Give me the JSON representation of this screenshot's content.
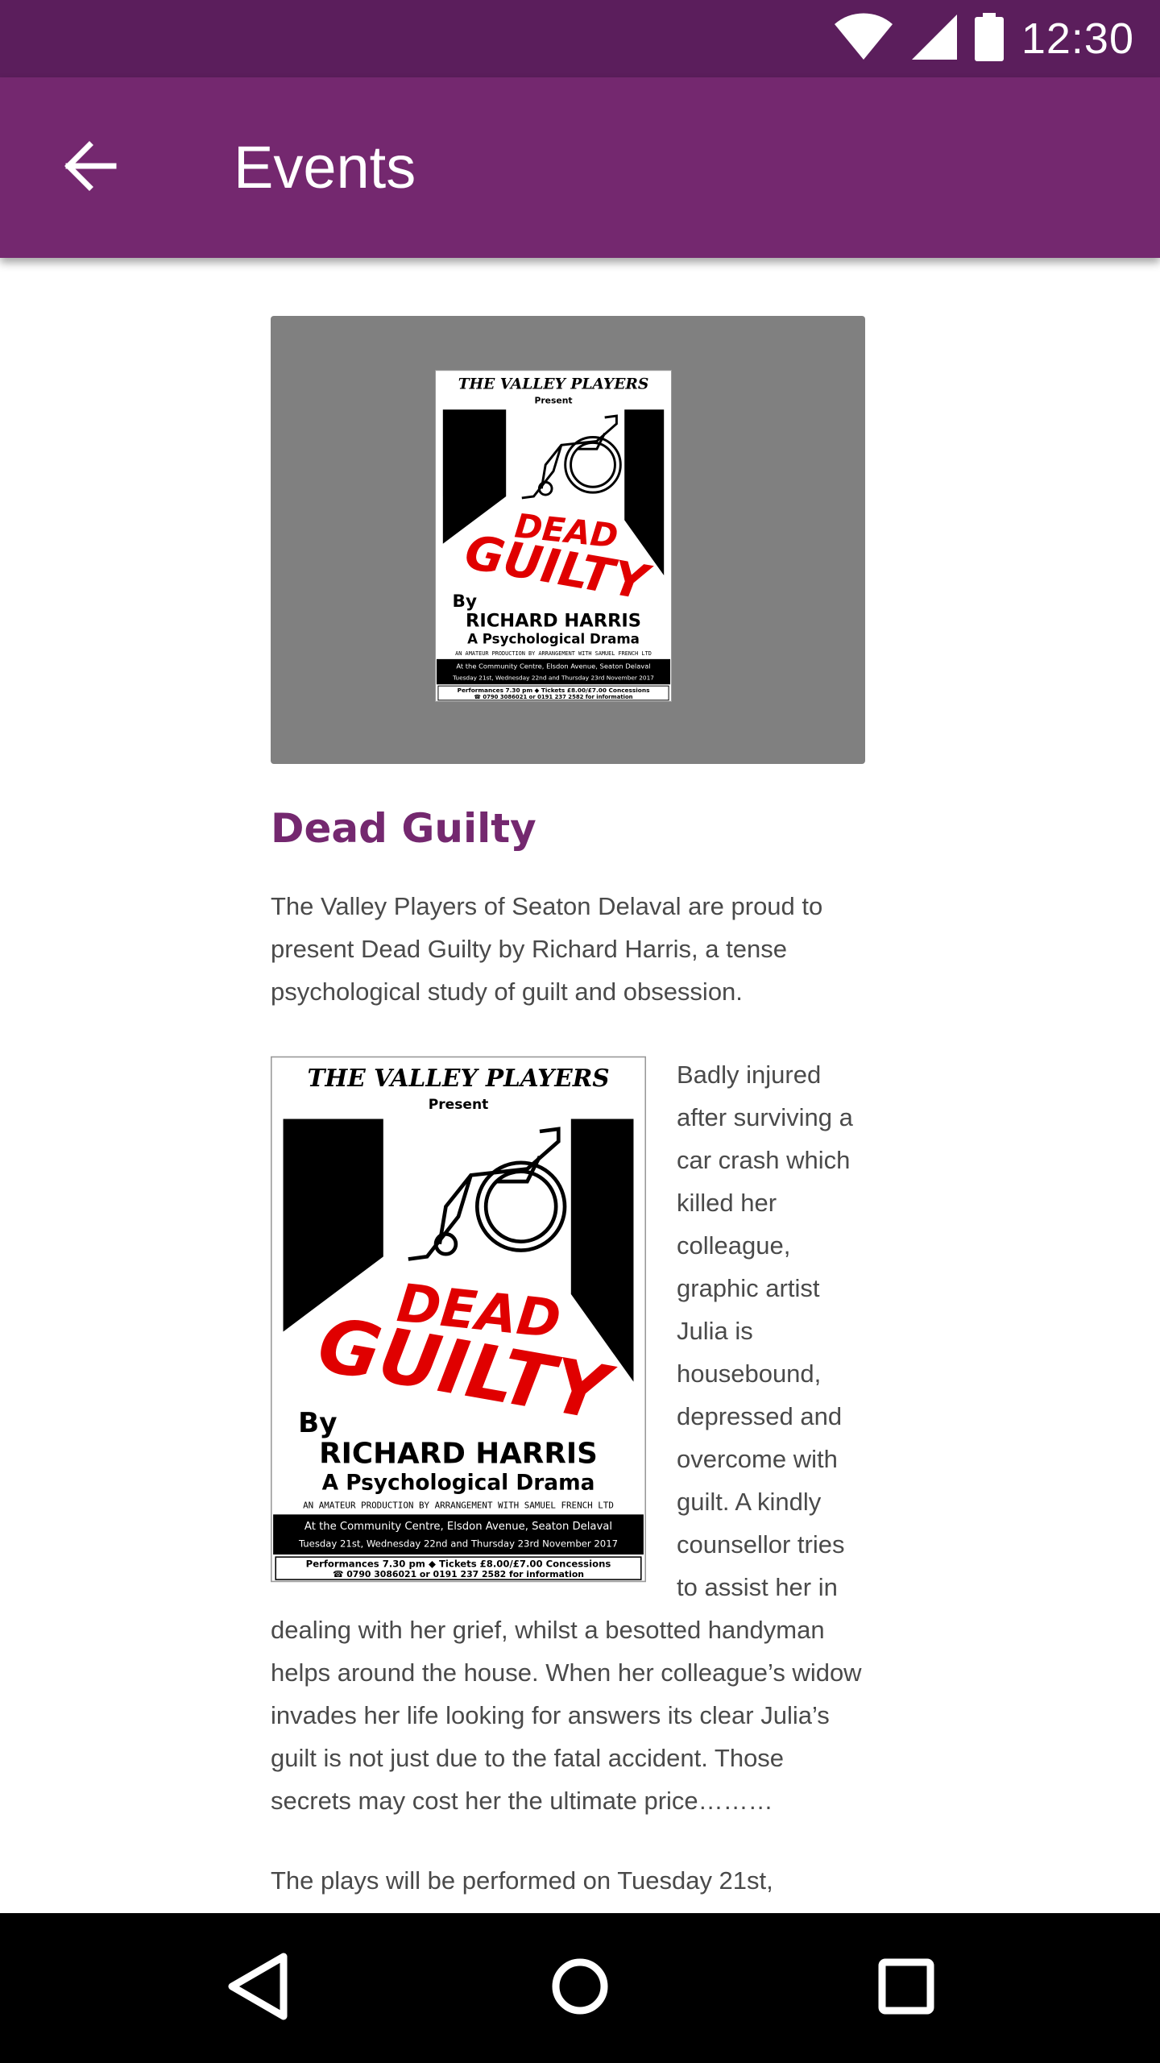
{
  "status_bar": {
    "time": "12:30"
  },
  "app_bar": {
    "title": "Events"
  },
  "event": {
    "title": "Dead Guilty",
    "intro": "The Valley Players of Seaton Delaval are proud to present Dead Guilty by Richard Harris, a tense psychological study of guilt and obsession.",
    "body": "Badly injured after surviving a car crash which killed her colleague, graphic artist Julia is housebound, depressed and overcome with guilt.  A kindly counsellor tries to assist her in dealing with her grief, whilst a besotted handyman helps around the house.  When her colleague’s widow invades her life looking for answers its clear Julia’s guilt is not just due to the fatal accident. Those secrets may cost her the ultimate price………",
    "more": "The plays will be performed on Tuesday 21st,"
  },
  "poster": {
    "header": "THE VALLEY PLAYERS",
    "present": "Present",
    "title_line1": "DEAD",
    "title_line2": "GUILTY",
    "by": "By",
    "author": "RICHARD HARRIS",
    "subtitle": "A Psychological Drama",
    "production": "AN AMATEUR PRODUCTION BY ARRANGEMENT WITH SAMUEL FRENCH LTD",
    "venue": "At the Community Centre, Elsdon Avenue, Seaton Delaval",
    "dates": "Tuesday 21st, Wednesday 22nd and Thursday 23rd November 2017",
    "tickets": "Performances 7.30 pm ◆ Tickets £8.00/£7.00 Concessions",
    "phone": "☎ 0790 3086021 or 0191 237 2582 for information"
  },
  "colors": {
    "status_bar": "#5b1e5c",
    "app_bar": "#74286f",
    "title": "#74286f",
    "poster_red": "#e00000"
  },
  "icons": [
    "wifi-icon",
    "signal-icon",
    "battery-icon",
    "back-arrow-icon",
    "nav-back-icon",
    "nav-home-icon",
    "nav-recents-icon"
  ]
}
